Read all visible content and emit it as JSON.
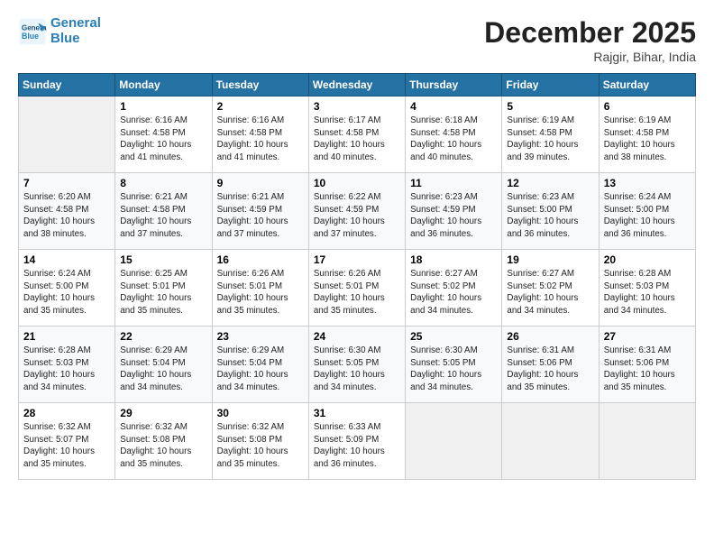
{
  "header": {
    "logo_line1": "General",
    "logo_line2": "Blue",
    "month": "December 2025",
    "location": "Rajgir, Bihar, India"
  },
  "weekdays": [
    "Sunday",
    "Monday",
    "Tuesday",
    "Wednesday",
    "Thursday",
    "Friday",
    "Saturday"
  ],
  "weeks": [
    [
      {
        "day": "",
        "info": ""
      },
      {
        "day": "1",
        "info": "Sunrise: 6:16 AM\nSunset: 4:58 PM\nDaylight: 10 hours\nand 41 minutes."
      },
      {
        "day": "2",
        "info": "Sunrise: 6:16 AM\nSunset: 4:58 PM\nDaylight: 10 hours\nand 41 minutes."
      },
      {
        "day": "3",
        "info": "Sunrise: 6:17 AM\nSunset: 4:58 PM\nDaylight: 10 hours\nand 40 minutes."
      },
      {
        "day": "4",
        "info": "Sunrise: 6:18 AM\nSunset: 4:58 PM\nDaylight: 10 hours\nand 40 minutes."
      },
      {
        "day": "5",
        "info": "Sunrise: 6:19 AM\nSunset: 4:58 PM\nDaylight: 10 hours\nand 39 minutes."
      },
      {
        "day": "6",
        "info": "Sunrise: 6:19 AM\nSunset: 4:58 PM\nDaylight: 10 hours\nand 38 minutes."
      }
    ],
    [
      {
        "day": "7",
        "info": "Sunrise: 6:20 AM\nSunset: 4:58 PM\nDaylight: 10 hours\nand 38 minutes."
      },
      {
        "day": "8",
        "info": "Sunrise: 6:21 AM\nSunset: 4:58 PM\nDaylight: 10 hours\nand 37 minutes."
      },
      {
        "day": "9",
        "info": "Sunrise: 6:21 AM\nSunset: 4:59 PM\nDaylight: 10 hours\nand 37 minutes."
      },
      {
        "day": "10",
        "info": "Sunrise: 6:22 AM\nSunset: 4:59 PM\nDaylight: 10 hours\nand 37 minutes."
      },
      {
        "day": "11",
        "info": "Sunrise: 6:23 AM\nSunset: 4:59 PM\nDaylight: 10 hours\nand 36 minutes."
      },
      {
        "day": "12",
        "info": "Sunrise: 6:23 AM\nSunset: 5:00 PM\nDaylight: 10 hours\nand 36 minutes."
      },
      {
        "day": "13",
        "info": "Sunrise: 6:24 AM\nSunset: 5:00 PM\nDaylight: 10 hours\nand 36 minutes."
      }
    ],
    [
      {
        "day": "14",
        "info": "Sunrise: 6:24 AM\nSunset: 5:00 PM\nDaylight: 10 hours\nand 35 minutes."
      },
      {
        "day": "15",
        "info": "Sunrise: 6:25 AM\nSunset: 5:01 PM\nDaylight: 10 hours\nand 35 minutes."
      },
      {
        "day": "16",
        "info": "Sunrise: 6:26 AM\nSunset: 5:01 PM\nDaylight: 10 hours\nand 35 minutes."
      },
      {
        "day": "17",
        "info": "Sunrise: 6:26 AM\nSunset: 5:01 PM\nDaylight: 10 hours\nand 35 minutes."
      },
      {
        "day": "18",
        "info": "Sunrise: 6:27 AM\nSunset: 5:02 PM\nDaylight: 10 hours\nand 34 minutes."
      },
      {
        "day": "19",
        "info": "Sunrise: 6:27 AM\nSunset: 5:02 PM\nDaylight: 10 hours\nand 34 minutes."
      },
      {
        "day": "20",
        "info": "Sunrise: 6:28 AM\nSunset: 5:03 PM\nDaylight: 10 hours\nand 34 minutes."
      }
    ],
    [
      {
        "day": "21",
        "info": "Sunrise: 6:28 AM\nSunset: 5:03 PM\nDaylight: 10 hours\nand 34 minutes."
      },
      {
        "day": "22",
        "info": "Sunrise: 6:29 AM\nSunset: 5:04 PM\nDaylight: 10 hours\nand 34 minutes."
      },
      {
        "day": "23",
        "info": "Sunrise: 6:29 AM\nSunset: 5:04 PM\nDaylight: 10 hours\nand 34 minutes."
      },
      {
        "day": "24",
        "info": "Sunrise: 6:30 AM\nSunset: 5:05 PM\nDaylight: 10 hours\nand 34 minutes."
      },
      {
        "day": "25",
        "info": "Sunrise: 6:30 AM\nSunset: 5:05 PM\nDaylight: 10 hours\nand 34 minutes."
      },
      {
        "day": "26",
        "info": "Sunrise: 6:31 AM\nSunset: 5:06 PM\nDaylight: 10 hours\nand 35 minutes."
      },
      {
        "day": "27",
        "info": "Sunrise: 6:31 AM\nSunset: 5:06 PM\nDaylight: 10 hours\nand 35 minutes."
      }
    ],
    [
      {
        "day": "28",
        "info": "Sunrise: 6:32 AM\nSunset: 5:07 PM\nDaylight: 10 hours\nand 35 minutes."
      },
      {
        "day": "29",
        "info": "Sunrise: 6:32 AM\nSunset: 5:08 PM\nDaylight: 10 hours\nand 35 minutes."
      },
      {
        "day": "30",
        "info": "Sunrise: 6:32 AM\nSunset: 5:08 PM\nDaylight: 10 hours\nand 35 minutes."
      },
      {
        "day": "31",
        "info": "Sunrise: 6:33 AM\nSunset: 5:09 PM\nDaylight: 10 hours\nand 36 minutes."
      },
      {
        "day": "",
        "info": ""
      },
      {
        "day": "",
        "info": ""
      },
      {
        "day": "",
        "info": ""
      }
    ]
  ]
}
